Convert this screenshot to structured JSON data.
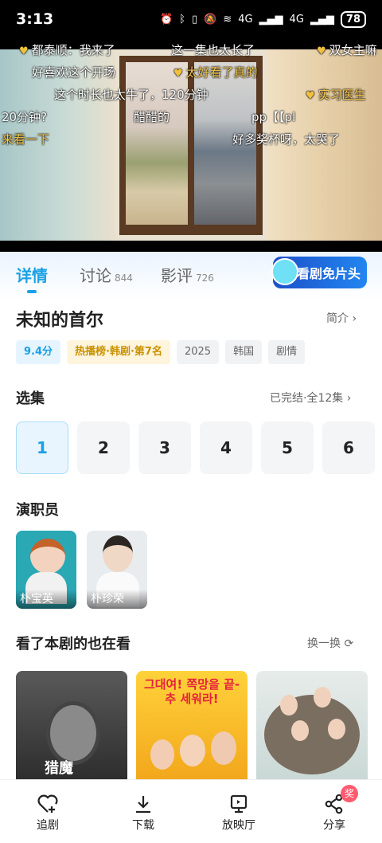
{
  "status_bar": {
    "time": "3:13",
    "signal1": "4G",
    "signal2": "4G",
    "battery": "78"
  },
  "danmaku": [
    "都泰顺：我来了",
    "这一集也太长了",
    "双女主嘛",
    "好喜欢这个开场",
    "太好看了真的",
    "这个时长也太牛了，120分钟",
    "实习医生",
    "20分钟?",
    "醋醋的",
    "pp【【pl",
    "来看一下",
    "好多奖杯呀，太哭了"
  ],
  "tabs": [
    {
      "label": "详情",
      "count": ""
    },
    {
      "label": "讨论",
      "count": "844"
    },
    {
      "label": "影评",
      "count": "726"
    }
  ],
  "promo_banner": "看剧免片头",
  "show": {
    "title": "未知的首尔",
    "intro_link": "简介",
    "tags": [
      "9.4分",
      "热播榜·韩剧·第7名",
      "2025",
      "韩国",
      "剧情"
    ]
  },
  "episodes": {
    "section_title": "选集",
    "status": "已完结·全12集",
    "items": [
      "1",
      "2",
      "3",
      "4",
      "5",
      "6"
    ]
  },
  "cast": {
    "section_title": "演职员",
    "members": [
      "朴宝英",
      "朴珍荣"
    ]
  },
  "recommend": {
    "section_title": "看了本剧的也在看",
    "refresh_label": "换一换",
    "poster1_text": "猎魔",
    "poster2_text": "그대여! 쪽망을 끝-추 세워라!"
  },
  "bottom_nav": [
    {
      "label": "追剧",
      "icon": "heart-plus-icon"
    },
    {
      "label": "下载",
      "icon": "download-icon"
    },
    {
      "label": "放映厅",
      "icon": "screen-icon"
    },
    {
      "label": "分享",
      "icon": "share-icon",
      "badge": "奖"
    }
  ],
  "colors": {
    "accent": "#1aa0e6",
    "badge": "#ff5b6e"
  }
}
